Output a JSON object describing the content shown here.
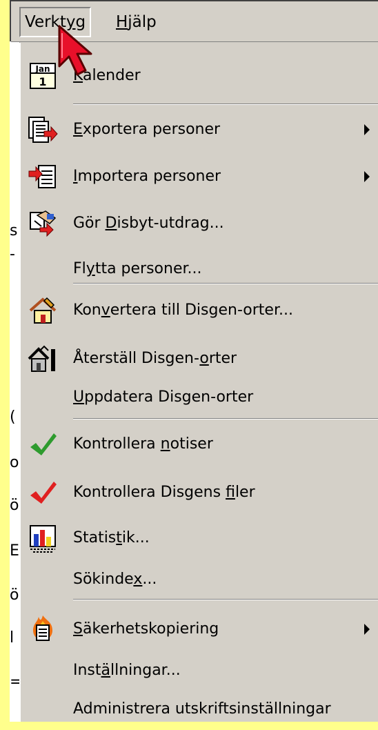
{
  "menubar": {
    "items": [
      {
        "pre": "Verkt",
        "mn": "y",
        "post": "g"
      },
      {
        "pre": "",
        "mn": "H",
        "post": "jälp"
      }
    ]
  },
  "background_fragments": [
    "s",
    "-",
    "(",
    "o",
    "ö",
    "E",
    "ö",
    "l",
    "="
  ],
  "menu": {
    "items": [
      {
        "pre": "",
        "mn": "K",
        "post": "alender",
        "icon": "calendar-icon",
        "submenu": false
      },
      {
        "pre": "",
        "mn": "E",
        "post": "xportera personer",
        "icon": "export-persons-icon",
        "submenu": true
      },
      {
        "pre": "",
        "mn": "I",
        "post": "mportera personer",
        "icon": "import-persons-icon",
        "submenu": true
      },
      {
        "pre": "Gör ",
        "mn": "D",
        "post": "isbyt-utdrag...",
        "icon": "disbyt-extract-icon",
        "submenu": false
      },
      {
        "pre": "Fl",
        "mn": "y",
        "post": "tta personer...",
        "icon": "",
        "submenu": false
      },
      {
        "pre": "Kon",
        "mn": "v",
        "post": "ertera till Disgen-orter...",
        "icon": "convert-places-icon",
        "submenu": false
      },
      {
        "pre": "Återställ Disgen-",
        "mn": "o",
        "post": "rter",
        "icon": "restore-places-icon",
        "submenu": false
      },
      {
        "pre": "",
        "mn": "U",
        "post": "ppdatera Disgen-orter",
        "icon": "",
        "submenu": false
      },
      {
        "pre": "Kontrollera ",
        "mn": "n",
        "post": "otiser",
        "icon": "green-checkmark-icon",
        "submenu": false
      },
      {
        "pre": "Kontrollera Disgens ",
        "mn": "f",
        "post": "iler",
        "icon": "red-checkmark-icon",
        "submenu": false
      },
      {
        "pre": "Statis",
        "mn": "t",
        "post": "ik...",
        "icon": "statistics-chart-icon",
        "submenu": false
      },
      {
        "pre": "Sökinde",
        "mn": "x",
        "post": "...",
        "icon": "",
        "submenu": false
      },
      {
        "pre": "",
        "mn": "S",
        "post": "äkerhetskopiering",
        "icon": "backup-fire-icon",
        "submenu": true
      },
      {
        "pre": "Inst",
        "mn": "ä",
        "post": "llningar...",
        "icon": "",
        "submenu": false
      },
      {
        "pre": "Administrera utskriftsinställningar",
        "mn": "",
        "post": "",
        "icon": "",
        "submenu": false
      }
    ]
  },
  "colors": {
    "background": "#ffff8c",
    "menu_face": "#d4d0c8",
    "check_green": "#2e9b2e",
    "check_red": "#e02020",
    "cursor_red": "#e8102a"
  }
}
